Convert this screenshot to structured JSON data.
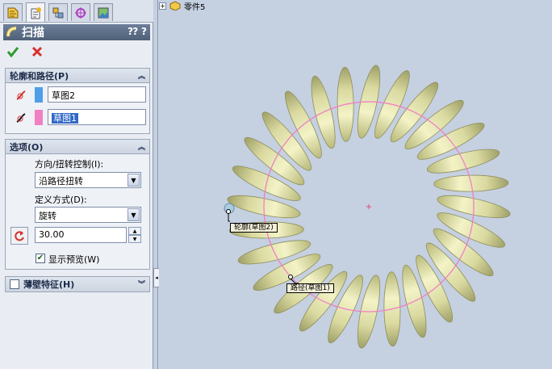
{
  "tabs": [
    {
      "icon": "feature-manager-icon"
    },
    {
      "icon": "property-manager-icon",
      "active": true
    },
    {
      "icon": "configuration-manager-icon"
    },
    {
      "icon": "dimxpert-icon"
    },
    {
      "icon": "display-manager-icon"
    }
  ],
  "title": "扫描",
  "help_text": "?",
  "profile_path": {
    "header": "轮廓和路径(P)",
    "profile_value": "草图2",
    "path_value": "草图1",
    "profile_color": "#4f9ee8",
    "path_color": "#f07fc4"
  },
  "options": {
    "header": "选项(O)",
    "orientation_label": "方向/扭转控制(I):",
    "orientation_value": "沿路径扭转",
    "define_label": "定义方式(D):",
    "define_value": "旋转",
    "angle_value": "30.00",
    "show_preview_label": "显示预览(W)",
    "show_preview_checked": true
  },
  "thin_feature": {
    "header": "薄壁特征(H)",
    "checked": false
  },
  "tree": {
    "part_label": "零件5"
  },
  "callouts": {
    "profile_label": "轮廓(草图2)",
    "path_label": "路径(草图1)"
  },
  "colors": {
    "coil": "#dedea3",
    "path_circle": "#f07fc4",
    "accent_title": "#5a6b86"
  }
}
